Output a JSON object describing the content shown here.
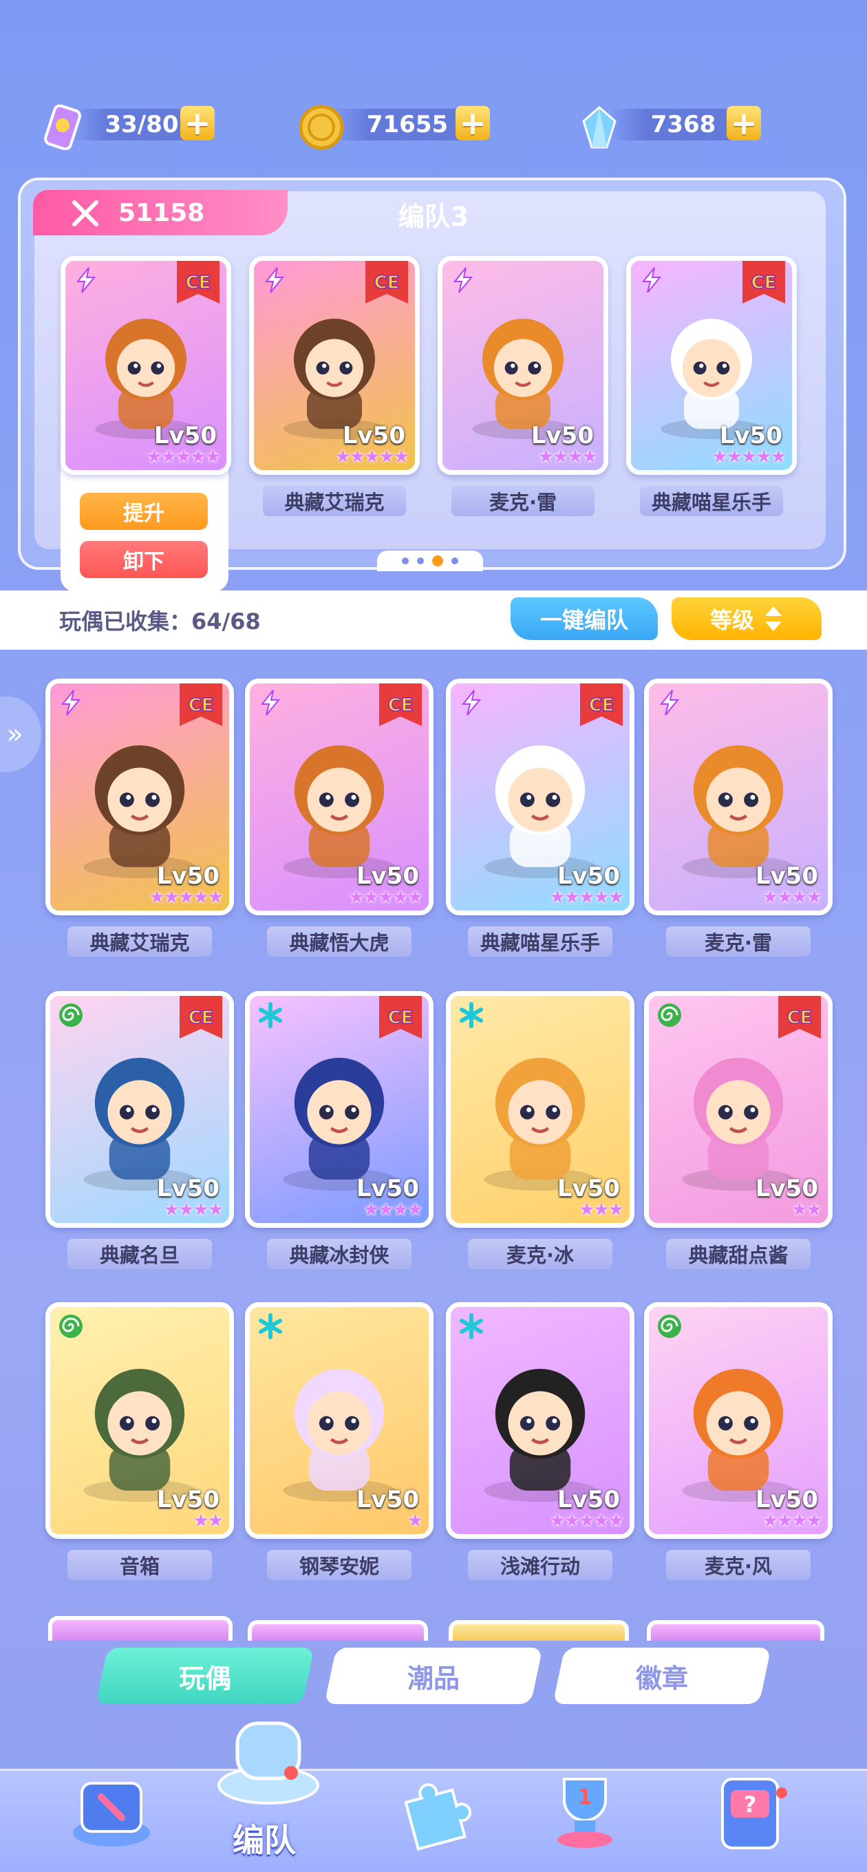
{
  "currencies": [
    {
      "icon": "ticket-icon",
      "value": "33/80"
    },
    {
      "icon": "coin-icon",
      "value": "71655"
    },
    {
      "icon": "crystal-icon",
      "value": "7368"
    }
  ],
  "team": {
    "power": "51158",
    "title": "编队3",
    "members": [
      {
        "name": "",
        "level": "Lv50",
        "stars": "★★★★★",
        "char": "tiger"
      },
      {
        "name": "典藏艾瑞克",
        "level": "Lv50",
        "stars": "★★★★★",
        "char": "skull"
      },
      {
        "name": "麦克·雷",
        "level": "Lv50",
        "stars": "★★★★",
        "char": "helmet"
      },
      {
        "name": "典藏喵星乐手",
        "level": "Lv50",
        "stars": "★★★★★",
        "char": "cat"
      }
    ],
    "upgrade_label": "提升",
    "unequip_label": "卸下"
  },
  "collection": {
    "label": "玩偶已收集：64/68",
    "one_click_label": "一键编队",
    "sort_label": "等级"
  },
  "dolls": [
    {
      "name": "典藏艾瑞克",
      "level": "Lv50",
      "stars": "★★★★★",
      "elem": "lightning",
      "ce": true
    },
    {
      "name": "典藏悟大虎",
      "level": "Lv50",
      "stars": "★★★★★",
      "elem": "lightning",
      "ce": true
    },
    {
      "name": "典藏喵星乐手",
      "level": "Lv50",
      "stars": "★★★★★",
      "elem": "lightning",
      "ce": true
    },
    {
      "name": "麦克·雷",
      "level": "Lv50",
      "stars": "★★★★",
      "elem": "lightning",
      "ce": false
    },
    {
      "name": "典藏名旦",
      "level": "Lv50",
      "stars": "★★★★",
      "elem": "spiral",
      "ce": true
    },
    {
      "name": "典藏冰封侠",
      "level": "Lv50",
      "stars": "★★★★",
      "elem": "asterisk",
      "ce": true
    },
    {
      "name": "麦克·冰",
      "level": "Lv50",
      "stars": "★★★",
      "elem": "asterisk",
      "ce": false
    },
    {
      "name": "典藏甜点酱",
      "level": "Lv50",
      "stars": "★★",
      "elem": "spiral",
      "ce": true
    },
    {
      "name": "音箱",
      "level": "Lv50",
      "stars": "★★",
      "elem": "spiral",
      "ce": false
    },
    {
      "name": "钢琴安妮",
      "level": "Lv50",
      "stars": "★",
      "elem": "asterisk",
      "ce": false
    },
    {
      "name": "浅滩行动",
      "level": "Lv50",
      "stars": "★★★★★",
      "elem": "asterisk",
      "ce": false
    },
    {
      "name": "麦克·风",
      "level": "Lv50",
      "stars": "★★★★",
      "elem": "spiral",
      "ce": false
    }
  ],
  "bottom_tabs": [
    {
      "label": "玩偶",
      "active": true
    },
    {
      "label": "潮品",
      "active": false
    },
    {
      "label": "徽章",
      "active": false
    }
  ],
  "nav": {
    "active_label": "编队",
    "items": [
      "shop-icon",
      "whistle-icon",
      "puzzle-icon",
      "trophy-icon",
      "slot-machine-icon"
    ]
  },
  "colors": {
    "accent_pink": "#ff5aa5",
    "accent_orange": "#ff9a1e",
    "accent_teal": "#3fd6c0",
    "star_purple": "#e07cff"
  }
}
